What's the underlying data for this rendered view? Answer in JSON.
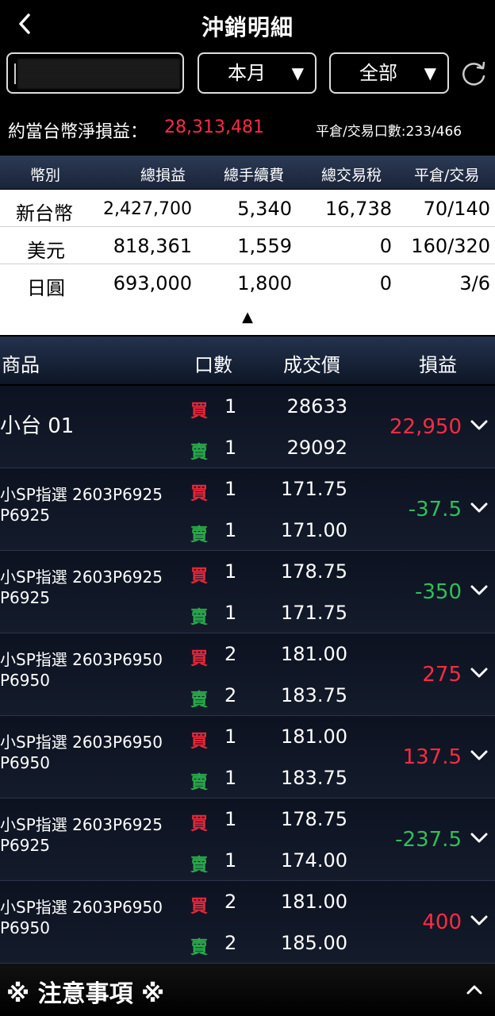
{
  "header": {
    "title": "沖銷明細",
    "back_icon": "chevron-left-icon"
  },
  "filters": {
    "account_value": "",
    "period": {
      "selected": "本月"
    },
    "scope": {
      "selected": "全部"
    },
    "refresh_icon": "refresh-icon"
  },
  "summary": {
    "net_label": "約當台幣淨損益：",
    "net_value": "28,313,481",
    "count_label": "平倉/交易口數:233/466"
  },
  "currency_table": {
    "headers": [
      "幣別",
      "總損益",
      "總手續費",
      "總交易稅",
      "平倉/交易"
    ],
    "rows": [
      [
        "新台幣",
        "2,427,700",
        "5,340",
        "16,738",
        "70/140"
      ],
      [
        "美元",
        "818,361",
        "1,559",
        "0",
        "160/320"
      ],
      [
        "日圓",
        "693,000",
        "1,800",
        "0",
        "3/6"
      ]
    ],
    "collapse_symbol": "▲"
  },
  "trade_table": {
    "headers": {
      "product": "商品",
      "qty": "口數",
      "price": "成交價",
      "pnl": "損益"
    },
    "buy_label": "買",
    "sell_label": "賣",
    "rows": [
      {
        "name": "小台 01",
        "name2": "",
        "buy_qty": "1",
        "buy_price": "28633",
        "sell_qty": "1",
        "sell_price": "29092",
        "pnl": "22,950",
        "pnl_color": "red"
      },
      {
        "name": "小SP指選 2603P6925",
        "name2": "P6925",
        "buy_qty": "1",
        "buy_price": "171.75",
        "sell_qty": "1",
        "sell_price": "171.00",
        "pnl": "-37.5",
        "pnl_color": "green"
      },
      {
        "name": "小SP指選 2603P6925",
        "name2": "P6925",
        "buy_qty": "1",
        "buy_price": "178.75",
        "sell_qty": "1",
        "sell_price": "171.75",
        "pnl": "-350",
        "pnl_color": "green"
      },
      {
        "name": "小SP指選 2603P6950",
        "name2": "P6950",
        "buy_qty": "2",
        "buy_price": "181.00",
        "sell_qty": "2",
        "sell_price": "183.75",
        "pnl": "275",
        "pnl_color": "red"
      },
      {
        "name": "小SP指選 2603P6950",
        "name2": "P6950",
        "buy_qty": "1",
        "buy_price": "181.00",
        "sell_qty": "1",
        "sell_price": "183.75",
        "pnl": "137.5",
        "pnl_color": "red"
      },
      {
        "name": "小SP指選 2603P6925",
        "name2": "P6925",
        "buy_qty": "1",
        "buy_price": "178.75",
        "sell_qty": "1",
        "sell_price": "174.00",
        "pnl": "-237.5",
        "pnl_color": "green"
      },
      {
        "name": "小SP指選 2603P6950",
        "name2": "P6950",
        "buy_qty": "2",
        "buy_price": "181.00",
        "sell_qty": "2",
        "sell_price": "185.00",
        "pnl": "400",
        "pnl_color": "red"
      }
    ]
  },
  "notice": {
    "label": "※ 注意事項 ※"
  },
  "colors": {
    "profit": "#ff2a45",
    "loss": "#2fc05a",
    "buy": "#e8263a",
    "sell": "#29a84a"
  }
}
